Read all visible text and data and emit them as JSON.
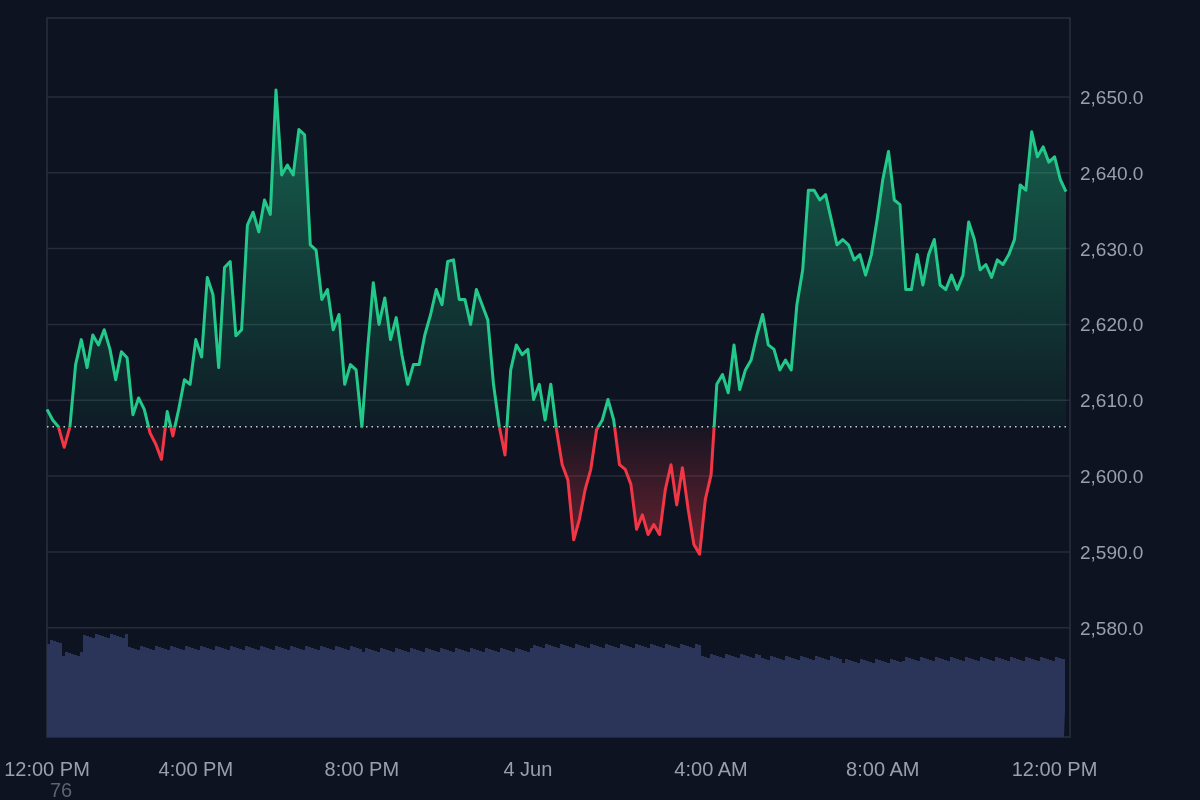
{
  "chart": {
    "chart_data": {
      "type": "area",
      "grid": true,
      "ylim": [
        2565.6,
        2660.4
      ],
      "yticks": [
        {
          "value": 2580,
          "label": "2,580.0"
        },
        {
          "value": 2590,
          "label": "2,590.0"
        },
        {
          "value": 2600,
          "label": "2,600.0"
        },
        {
          "value": 2610,
          "label": "2,610.0"
        },
        {
          "value": 2620,
          "label": "2,620.0"
        },
        {
          "value": 2630,
          "label": "2,630.0"
        },
        {
          "value": 2640,
          "label": "2,640.0"
        },
        {
          "value": 2650,
          "label": "2,650.0"
        }
      ],
      "categories": [
        "12:00 PM",
        null,
        null,
        null,
        null,
        null,
        null,
        null,
        null,
        null,
        null,
        null,
        null,
        null,
        null,
        null,
        null,
        null,
        null,
        null,
        null,
        null,
        null,
        null,
        null,
        null,
        "4:00 PM",
        null,
        null,
        null,
        null,
        null,
        null,
        null,
        null,
        null,
        null,
        null,
        null,
        null,
        null,
        null,
        null,
        null,
        null,
        null,
        null,
        null,
        null,
        null,
        null,
        null,
        null,
        null,
        null,
        "8:00 PM",
        null,
        null,
        null,
        null,
        null,
        null,
        null,
        null,
        null,
        null,
        null,
        null,
        null,
        null,
        null,
        null,
        null,
        null,
        null,
        null,
        null,
        null,
        null,
        null,
        null,
        null,
        null,
        null,
        "4 Jun",
        null,
        null,
        null,
        null,
        null,
        null,
        null,
        null,
        null,
        null,
        null,
        null,
        null,
        null,
        null,
        null,
        null,
        null,
        null,
        null,
        null,
        null,
        null,
        null,
        null,
        null,
        null,
        null,
        null,
        null,
        null,
        "4:00 AM",
        null,
        null,
        null,
        null,
        null,
        null,
        null,
        null,
        null,
        null,
        null,
        null,
        null,
        null,
        null,
        null,
        null,
        null,
        null,
        null,
        null,
        null,
        null,
        null,
        null,
        null,
        null,
        null,
        null,
        "8:00 AM",
        null,
        null,
        null,
        null,
        null,
        null,
        null,
        null,
        null,
        null,
        null,
        null,
        null,
        null,
        null,
        null,
        null,
        null,
        null,
        null,
        null,
        null,
        null,
        null,
        null,
        null,
        null,
        null,
        null,
        "12:00 PM",
        null,
        null
      ],
      "series": [
        {
          "color": "#22c98a",
          "values": [
            2608.8,
            2607.4,
            2606.5,
            2603.8,
            2606.5,
            2614.7,
            2618,
            2614.3,
            2618.6,
            2617.3,
            2619.3,
            2616.7,
            2612.7,
            2616.4,
            2615.6,
            2608.1,
            2610.3,
            2608.8,
            2605.7,
            2604.2,
            2602.2,
            2608.5,
            2605.3,
            2608.8,
            2612.7,
            2612.1,
            2618,
            2615.7,
            2626.2,
            2623.9,
            2614.3,
            2627.5,
            2628.3,
            2618.5,
            2619.3,
            2633.1,
            2634.8,
            2632.2,
            2636.4,
            2634.5,
            2650.9,
            2639.7,
            2641,
            2639.7,
            2645.7,
            2645,
            2630.5,
            2629.8,
            2623.3,
            2624.6,
            2619.3,
            2621.3,
            2612.1,
            2614.7,
            2614,
            2606.5,
            2616.7,
            2625.5,
            2620,
            2623.5,
            2618,
            2620.9,
            2616,
            2612.1,
            2614.7,
            2614.7,
            2618.6,
            2621.3,
            2624.6,
            2622.6,
            2628.3,
            2628.5,
            2623.3,
            2623.3,
            2620,
            2624.6,
            2622.6,
            2620.6,
            2612.1,
            2606.5,
            2602.8,
            2614,
            2617.3,
            2616,
            2616.7,
            2610.1,
            2612.1,
            2607.4,
            2612.1,
            2606.1,
            2601.5,
            2599.5,
            2591.6,
            2594.3,
            2598.2,
            2600.9,
            2606.1,
            2607.4,
            2610.1,
            2607.4,
            2601.5,
            2600.9,
            2598.9,
            2593,
            2594.9,
            2592.3,
            2593.6,
            2592.3,
            2598.2,
            2601.5,
            2596.2,
            2601.1,
            2595.6,
            2591,
            2589.7,
            2596.9,
            2600.2,
            2612.1,
            2613.4,
            2611,
            2617.3,
            2611.4,
            2614,
            2615.3,
            2618.6,
            2621.3,
            2617.3,
            2616.7,
            2614,
            2615.3,
            2614,
            2622.6,
            2627.2,
            2637.7,
            2637.7,
            2636.4,
            2637.1,
            2633.8,
            2630.5,
            2631.2,
            2630.5,
            2628.5,
            2629.2,
            2626.5,
            2629.2,
            2633.8,
            2639.1,
            2642.8,
            2636.4,
            2635.8,
            2624.6,
            2624.6,
            2629.2,
            2625.2,
            2629.2,
            2631.2,
            2625.2,
            2624.6,
            2626.5,
            2624.6,
            2626.5,
            2633.5,
            2631.2,
            2627.2,
            2627.9,
            2626.2,
            2628.5,
            2627.9,
            2629.2,
            2631.2,
            2638.4,
            2637.7,
            2645.4,
            2642.1,
            2643.4,
            2641.4,
            2642.1,
            2639.1,
            2637.5
          ]
        }
      ],
      "ref_lines": [
        {
          "axis": "y",
          "value": 2606.5
        }
      ]
    },
    "footer_label": "76"
  }
}
